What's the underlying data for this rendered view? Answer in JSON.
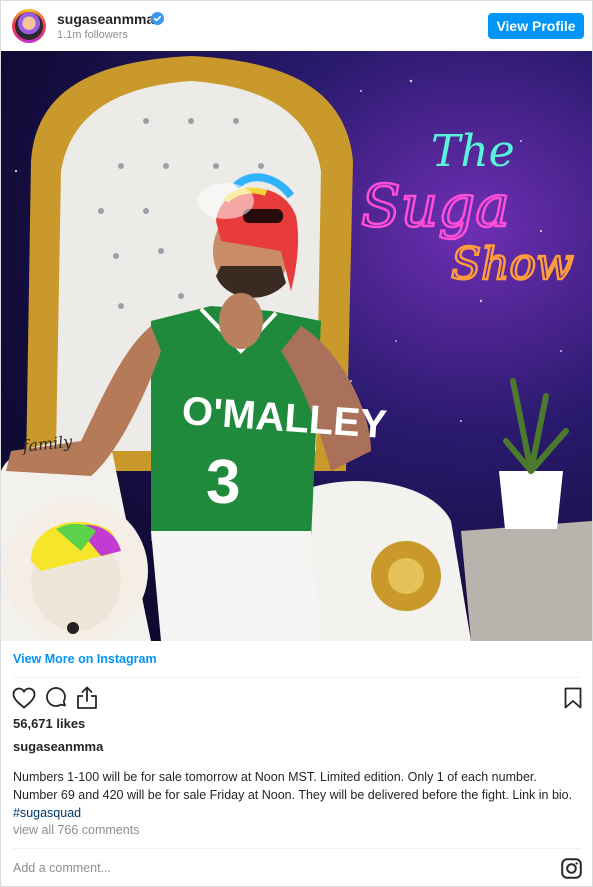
{
  "header": {
    "username": "sugaseanmma",
    "followers": "1.1m followers",
    "view_profile_label": "View Profile"
  },
  "photo": {
    "jersey_text": "O'MALLEY",
    "jersey_number": "3",
    "neon_line1": "The",
    "neon_line2": "Suga",
    "neon_line3": "Show",
    "tattoo_text": "family"
  },
  "links": {
    "view_more": "View More on Instagram"
  },
  "post": {
    "likes": "56,671 likes",
    "caption_user": "sugaseanmma",
    "caption_text": "Numbers 1-100 will be for sale tomorrow at Noon MST. Limited edition. Only 1 of each number. Number 69 and 420 will be for sale Friday at Noon. They will be delivered before the fight. Link in bio.",
    "caption_hashtag": "#sugasquad",
    "view_comments": "view all 766 comments",
    "add_comment_placeholder": "Add a comment..."
  },
  "icons": [
    "verified-badge-icon",
    "heart-icon",
    "comment-icon",
    "share-icon",
    "bookmark-icon",
    "instagram-logo-icon"
  ],
  "colors": {
    "accent": "#0095f6",
    "hashtag": "#00376b",
    "jersey": "#1f8a3b",
    "neon_pink": "#ff4fd8",
    "neon_teal": "#58f5d8",
    "neon_orange": "#ff9d3c"
  }
}
